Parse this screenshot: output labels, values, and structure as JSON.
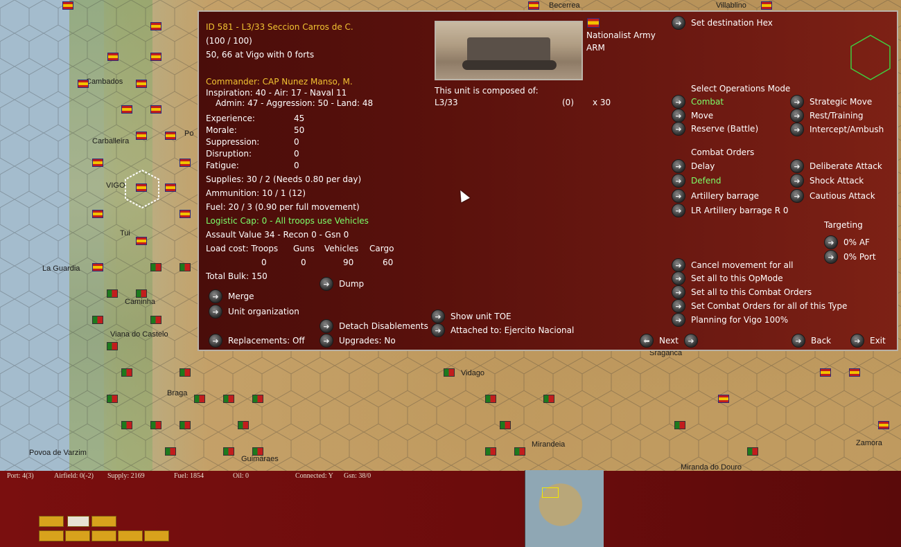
{
  "map": {
    "labels": [
      "Becerrea",
      "Villablino",
      "Cambados",
      "Carballeira",
      "Po",
      "VIGO",
      "Tui",
      "La Guardia",
      "Caminha",
      "Viana do Castelo",
      "Braga",
      "Vidago",
      "Mirandeia",
      "Povoa de Varzim",
      "Guimaraes",
      "Miranda do Douro",
      "Sraganca",
      "Zamora"
    ]
  },
  "unit": {
    "id_line": "ID 581 - L3/33 Seccion Carros de C.",
    "strength": "(100 / 100)",
    "location": "50, 66 at Vigo with 0 forts",
    "commander": "Commander: CAP Nunez Manso, M.",
    "ratings1": "Inspiration: 40 - Air: 17 - Naval 11",
    "ratings2": "Admin: 47 - Aggression: 50 - Land: 48",
    "stats": [
      {
        "label": "Experience:",
        "value": "45"
      },
      {
        "label": "Morale:",
        "value": "50"
      },
      {
        "label": "Suppression:",
        "value": "0"
      },
      {
        "label": "Disruption:",
        "value": "0"
      },
      {
        "label": "Fatigue:",
        "value": "0"
      }
    ],
    "supplies": "Supplies: 30 / 2 (Needs 0.80 per day)",
    "ammunition": "Ammunition: 10 / 1 (12)",
    "fuel": "Fuel: 20 / 3 (0.90 per full movement)",
    "logistic": "Logistic Cap: 0 - All troops use Vehicles",
    "assault": "Assault Value 34 - Recon 0 - Gsn 0",
    "load_headers": [
      "Load cost: Troops",
      "Guns",
      "Vehicles",
      "Cargo"
    ],
    "load_values": [
      "0",
      "0",
      "90",
      "60"
    ],
    "total_bulk": "Total Bulk: 150",
    "faction": "Nationalist Army",
    "type": "ARM",
    "composed_of": "This unit is composed of:",
    "composition": {
      "name": "L3/33",
      "count": "(0)",
      "mult": "x 30"
    }
  },
  "buttons_left": {
    "merge": "Merge",
    "unit_org": "Unit organization",
    "replacements": "Replacements: Off",
    "dump": "Dump",
    "detach": "Detach Disablements",
    "upgrades": "Upgrades: No",
    "show_toe": "Show unit TOE",
    "attached": "Attached to: Ejercito Nacional"
  },
  "orders": {
    "set_destination": "Set destination Hex",
    "ops_header": "Select Operations Mode",
    "ops": [
      "Combat",
      "Move",
      "Reserve (Battle)",
      "Strategic Move",
      "Rest/Training",
      "Intercept/Ambush"
    ],
    "combat_header": "Combat Orders",
    "combat_left": [
      "Delay",
      "Defend",
      "Artillery barrage",
      "LR Artillery barrage R 0"
    ],
    "combat_right": [
      "Deliberate Attack",
      "Shock Attack",
      "Cautious Attack"
    ],
    "targeting_header": "Targeting",
    "targeting": [
      "0% AF",
      "0% Port"
    ],
    "bulk_actions": [
      "Cancel movement for all",
      "Set all to this OpMode",
      "Set all to this Combat Orders",
      "Set Combat Orders for all of this Type",
      "Planning for Vigo 100%"
    ],
    "next": "Next",
    "back": "Back",
    "exit": "Exit"
  },
  "statusbar": {
    "port": "Port: 4(3)",
    "airfield": "Airfield: 0(-2)",
    "supply": "Supply: 2169",
    "fuel": "Fuel: 1854",
    "oil": "Oil: 0",
    "connected": "Connected: Y",
    "gsn": "Gsn: 38/0"
  },
  "colors": {
    "highlight_green": "#7cff6a",
    "title_yellow": "#f1c232",
    "dialog_bg": "#5a110c"
  }
}
